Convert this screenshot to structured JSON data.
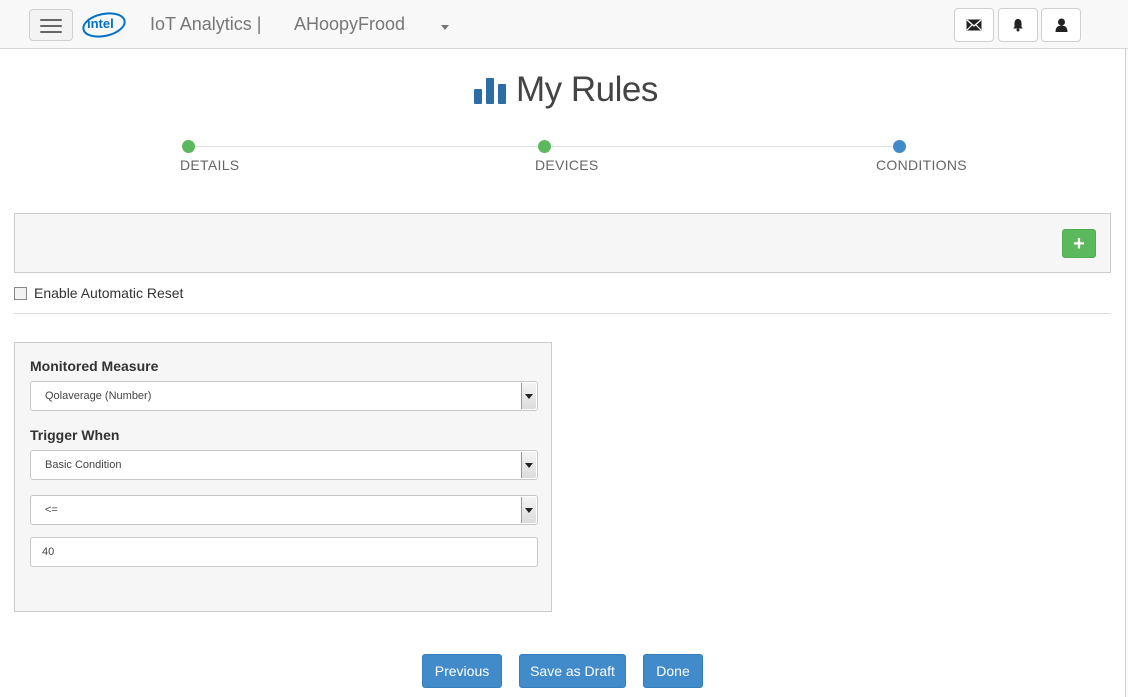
{
  "navbar": {
    "menu_icon": "hamburger-menu-icon",
    "logo_text": "intel",
    "brand": "IoT Analytics |",
    "account": "AHoopyFrood",
    "icons": [
      "envelope-icon",
      "bell-icon",
      "user-icon"
    ]
  },
  "page": {
    "title_icon": "bar-chart-icon",
    "title": "My Rules"
  },
  "wizard": {
    "steps": [
      {
        "label": "DETAILS",
        "state": "complete",
        "color": "#5cb85c"
      },
      {
        "label": "DEVICES",
        "state": "complete",
        "color": "#5cb85c"
      },
      {
        "label": "CONDITIONS",
        "state": "active",
        "color": "#428bca"
      }
    ]
  },
  "conditions": {
    "add_label": "+",
    "enable_reset_label": "Enable Automatic Reset",
    "enable_reset_checked": false
  },
  "form": {
    "monitored_measure_label": "Monitored Measure",
    "monitored_measure_value": "Qolaverage (Number)",
    "trigger_when_label": "Trigger When",
    "trigger_when_value": "Basic Condition",
    "operator_value": "<=",
    "threshold_value": "40"
  },
  "actions": {
    "previous": "Previous",
    "save_draft": "Save as Draft",
    "done": "Done"
  },
  "colors": {
    "primary": "#428bca",
    "success": "#5cb85c",
    "intel_blue": "#0071c5"
  }
}
